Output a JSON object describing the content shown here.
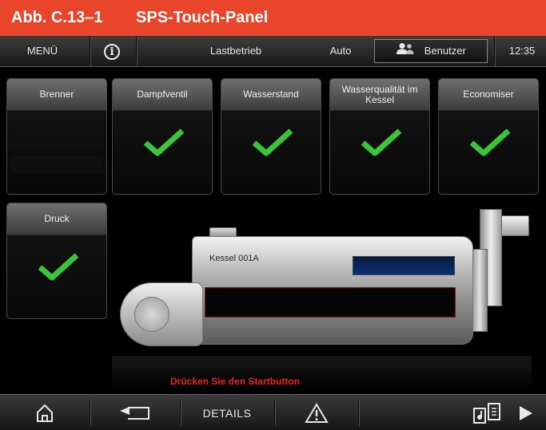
{
  "figure": {
    "number": "Abb. C.13–1",
    "title": "SPS-Touch-Panel"
  },
  "topbar": {
    "menu_label": "MENÜ",
    "info_symbol": "i",
    "mode_label": "Lastbetrieb",
    "auto_label": "Auto",
    "user_label": "Benutzer",
    "clock": "12:35"
  },
  "tiles": [
    {
      "label": "Brenner",
      "status": "none"
    },
    {
      "label": "Dampfventil",
      "status": "ok"
    },
    {
      "label": "Wasserstand",
      "status": "ok"
    },
    {
      "label": "Wasserqualität im Kessel",
      "status": "ok"
    },
    {
      "label": "Economiser",
      "status": "ok"
    },
    {
      "label": "Druck",
      "status": "ok"
    }
  ],
  "boiler": {
    "name": "Kessel 001A"
  },
  "status_message": "Drücken Sie den Startbutton",
  "bottombar": {
    "details_label": "DETAILS"
  },
  "colors": {
    "header_bg": "#e8452a",
    "check_green": "#3cc43a",
    "status_red": "#e82020"
  },
  "icons": {
    "home": "home-icon",
    "back": "back-arrow-icon",
    "warning": "warning-icon",
    "files": "files-icon",
    "play": "play-icon",
    "user": "user-icon",
    "info": "info-icon"
  }
}
